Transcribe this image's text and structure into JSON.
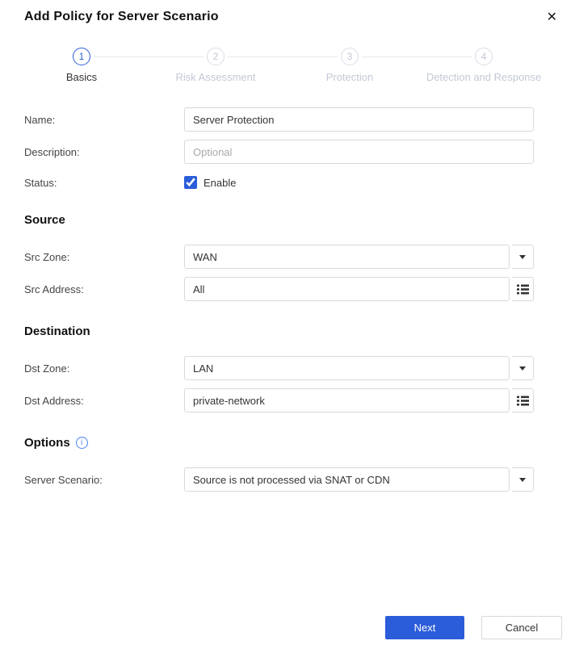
{
  "colors": {
    "accent": "#2b5cd9",
    "inactive_step": "#c2c8d4",
    "border": "#d9d9d9"
  },
  "dialog": {
    "title": "Add Policy for Server Scenario",
    "close_icon": "✕"
  },
  "icons": {
    "close": "x-close",
    "dropdown": "caret-down",
    "address_picker": "list",
    "options_info": "info-circle"
  },
  "stepper": {
    "steps": [
      {
        "number": "1",
        "label": "Basics",
        "active": true
      },
      {
        "number": "2",
        "label": "Risk Assessment",
        "active": false
      },
      {
        "number": "3",
        "label": "Protection",
        "active": false
      },
      {
        "number": "4",
        "label": "Detection and Response",
        "active": false
      }
    ]
  },
  "form": {
    "name": {
      "label": "Name:",
      "value": "Server Protection"
    },
    "description": {
      "label": "Description:",
      "placeholder": "Optional"
    },
    "status": {
      "label": "Status:",
      "checkbox_label": "Enable",
      "checked_attr": "checked"
    },
    "source_section": {
      "title": "Source"
    },
    "src_zone": {
      "label": "Src Zone:",
      "value": "WAN"
    },
    "src_address": {
      "label": "Src Address:",
      "value": "All"
    },
    "destination_section": {
      "title": "Destination"
    },
    "dst_zone": {
      "label": "Dst Zone:",
      "value": "LAN"
    },
    "dst_address": {
      "label": "Dst Address:",
      "value": "private-network"
    },
    "options_section": {
      "title": "Options",
      "info_glyph": "i"
    },
    "server_scenario": {
      "label": "Server Scenario:",
      "value": "Source is not processed via SNAT or CDN"
    }
  },
  "footer": {
    "next_label": "Next",
    "cancel_label": "Cancel"
  }
}
